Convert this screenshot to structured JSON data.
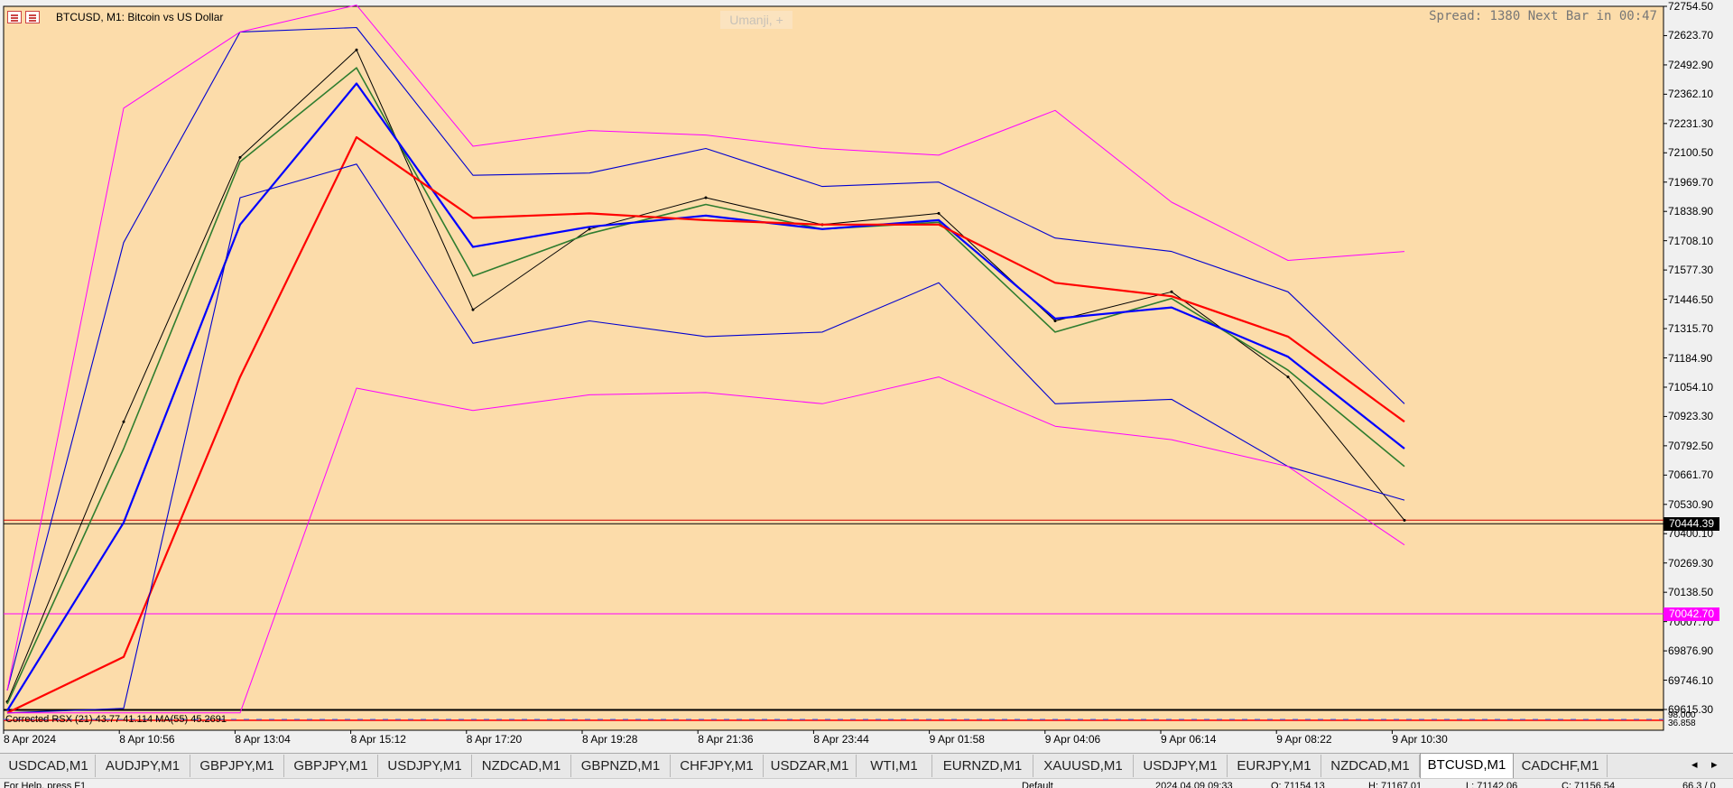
{
  "window": {
    "symbol_title": "BTCUSD, M1:  Bitcoin vs US Dollar",
    "spread_text": "Spread: 1380 Next Bar in 00:47",
    "template_label": "Umanji, +",
    "background_color": "#fcdcaa"
  },
  "price_axis": {
    "ticks": [
      "72754.50",
      "72623.70",
      "72492.90",
      "72362.10",
      "72231.30",
      "72100.50",
      "71969.70",
      "71838.90",
      "71708.10",
      "71577.30",
      "71446.50",
      "71315.70",
      "71184.90",
      "71054.10",
      "70923.30",
      "70792.50",
      "70661.70",
      "70530.90",
      "70400.10",
      "70269.30",
      "70138.50",
      "70007.70",
      "69876.90",
      "69746.10",
      "69615.30"
    ],
    "current_price": "70444.39",
    "alert_line_price": "70042.70",
    "current_color": "#000000",
    "alert_color": "#ff00ff",
    "min": 69615.3,
    "max": 72754.5
  },
  "time_axis": {
    "ticks": [
      "8 Apr 2024",
      "8 Apr 10:56",
      "8 Apr 13:04",
      "8 Apr 15:12",
      "8 Apr 17:20",
      "8 Apr 19:28",
      "8 Apr 21:36",
      "8 Apr 23:44",
      "9 Apr 01:58",
      "9 Apr 04:06",
      "9 Apr 06:14",
      "9 Apr 08:22",
      "9 Apr 10:30"
    ]
  },
  "indicator": {
    "label": "Corrected RSX (21) 43.77 41.114 MA(55) 45.2691",
    "axis_labels": [
      "98.000",
      "36.858"
    ]
  },
  "tabs": [
    {
      "label": "USDCAD,M1",
      "active": false
    },
    {
      "label": "AUDJPY,M1",
      "active": false
    },
    {
      "label": "GBPJPY,M1",
      "active": false
    },
    {
      "label": "GBPJPY,M1",
      "active": false
    },
    {
      "label": "USDJPY,M1",
      "active": false
    },
    {
      "label": "NZDCAD,M1",
      "active": false
    },
    {
      "label": "GBPNZD,M1",
      "active": false
    },
    {
      "label": "CHFJPY,M1",
      "active": false
    },
    {
      "label": "USDZAR,M1",
      "active": false
    },
    {
      "label": "WTI,M1",
      "active": false
    },
    {
      "label": "EURNZD,M1",
      "active": false
    },
    {
      "label": "XAUUSD,M1",
      "active": false
    },
    {
      "label": "USDJPY,M1",
      "active": false
    },
    {
      "label": "EURJPY,M1",
      "active": false
    },
    {
      "label": "NZDCAD,M1",
      "active": false
    },
    {
      "label": "BTCUSD,M1",
      "active": true
    },
    {
      "label": "CADCHF,M1",
      "active": false
    }
  ],
  "tab_scroll": {
    "left": "◂",
    "right": "▸"
  },
  "status": {
    "help": "For Help, press F1",
    "profile": "Default",
    "datetime": "2024.04.09 09:33",
    "open": "O: 71154.13",
    "high": "H: 71167.01",
    "low": "L: 71142.06",
    "close": "C: 71156.54",
    "traffic": "66.3 / 0"
  },
  "chart_data": {
    "type": "line",
    "x": [
      "8 Apr 2024",
      "8 Apr 10:56",
      "8 Apr 13:04",
      "8 Apr 15:12",
      "8 Apr 17:20",
      "8 Apr 19:28",
      "8 Apr 21:36",
      "8 Apr 23:44",
      "9 Apr 01:58",
      "9 Apr 04:06",
      "9 Apr 06:14",
      "9 Apr 08:22",
      "9 Apr 10:30"
    ],
    "ylim": [
      69615.3,
      72754.5
    ],
    "series": [
      {
        "role": "price",
        "color": "#000000",
        "values": [
          69650,
          70900,
          72080,
          72560,
          71400,
          71760,
          71900,
          71780,
          71830,
          71350,
          71480,
          71100,
          70460
        ]
      },
      {
        "role": "ma-fast",
        "color": "#2f7d2f",
        "values": [
          69640,
          70780,
          72060,
          72480,
          71550,
          71740,
          71870,
          71760,
          71790,
          71300,
          71450,
          71130,
          70700
        ]
      },
      {
        "role": "ma-mid",
        "color": "#0000ff",
        "values": [
          69610,
          70450,
          71780,
          72410,
          71680,
          71770,
          71820,
          71760,
          71800,
          71360,
          71410,
          71190,
          70780
        ]
      },
      {
        "role": "ma-slow",
        "color": "#ff0000",
        "values": [
          69600,
          69850,
          71100,
          72170,
          71810,
          71830,
          71800,
          71780,
          71780,
          71520,
          71460,
          71280,
          70900
        ]
      },
      {
        "role": "bb-upper",
        "color": "#0000d0",
        "values": [
          69700,
          71700,
          72640,
          72660,
          72000,
          72010,
          72120,
          71950,
          71970,
          71720,
          71660,
          71480,
          70980
        ]
      },
      {
        "role": "bb-lower",
        "color": "#0000d0",
        "values": [
          69600,
          69620,
          71900,
          72050,
          71250,
          71350,
          71280,
          71300,
          71520,
          70980,
          71000,
          70700,
          70550
        ]
      },
      {
        "role": "env-upper",
        "color": "#ff00ff",
        "values": [
          69700,
          72300,
          72640,
          72760,
          72130,
          72200,
          72180,
          72120,
          72090,
          72290,
          71880,
          71620,
          71660
        ]
      },
      {
        "role": "env-lower",
        "color": "#ff00ff",
        "values": [
          69600,
          69600,
          69600,
          71050,
          70950,
          71020,
          71030,
          70980,
          71100,
          70880,
          70820,
          70700,
          70350
        ]
      }
    ]
  }
}
